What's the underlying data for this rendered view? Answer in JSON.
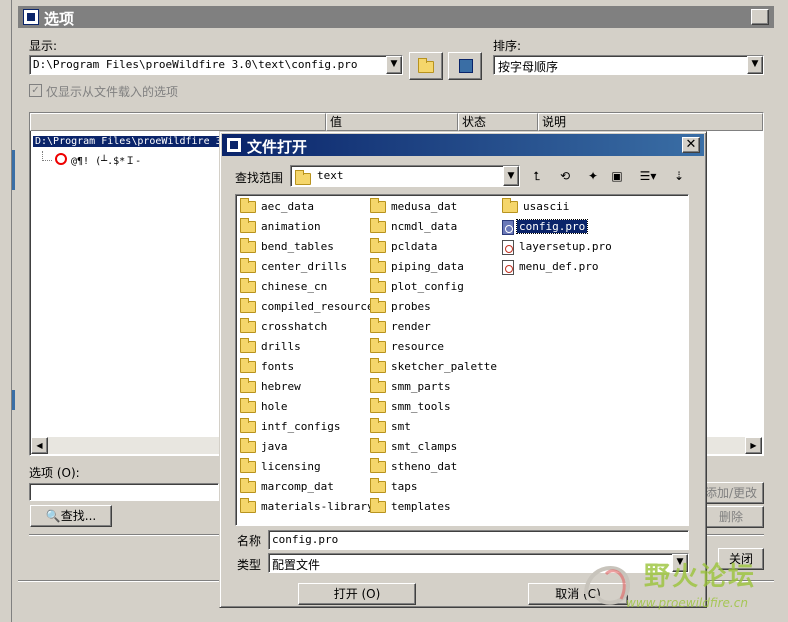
{
  "main_window": {
    "title": "选项",
    "display_label": "显示:",
    "display_path": "D:\\Program Files\\proeWildfire 3.0\\text\\config.pro",
    "sort_label": "排序:",
    "sort_value": "按字母顺序",
    "only_loaded_label": "仅显示从文件载入的选项",
    "columns": [
      "值",
      "状态",
      "说明"
    ],
    "tree_root": "D:\\Program Files\\proeWildfire 3",
    "tree_child": "@¶! (┴.$*Ｉ-",
    "option_label": "选项 (O):",
    "find_button": "查找...",
    "add_change_button": "添加/更改",
    "delete_button": "删除",
    "close_button": "关闭"
  },
  "file_dialog": {
    "title": "文件打开",
    "look_in_label": "查找范围",
    "look_in_value": "text",
    "column1": [
      "aec_data",
      "animation",
      "bend_tables",
      "center_drills",
      "chinese_cn",
      "compiled_resource",
      "crosshatch",
      "drills",
      "fonts",
      "hebrew",
      "hole",
      "intf_configs",
      "java",
      "licensing",
      "marcomp_dat",
      "materials-library"
    ],
    "column2": [
      "medusa_dat",
      "ncmdl_data",
      "pcldata",
      "piping_data",
      "plot_config",
      "probes",
      "render",
      "resource",
      "sketcher_palette",
      "smm_parts",
      "smm_tools",
      "smt",
      "smt_clamps",
      "stheno_dat",
      "taps",
      "templates"
    ],
    "column3": [
      {
        "name": "usascii",
        "type": "folder"
      },
      {
        "name": "config.pro",
        "type": "config-file",
        "selected": true
      },
      {
        "name": "layersetup.pro",
        "type": "file"
      },
      {
        "name": "menu_def.pro",
        "type": "file"
      }
    ],
    "name_label": "名称",
    "name_value": "config.pro",
    "type_label": "类型",
    "type_value": "配置文件",
    "open_button": "打开 (O)",
    "cancel_button": "取消 (C)"
  },
  "watermark": {
    "text": "野火论坛",
    "url": "www.proewildfire.cn"
  },
  "colors": {
    "active_title": "#0a246a",
    "inactive_title": "#808080",
    "selection": "#0a246a",
    "watermark": "#9bc43a"
  }
}
